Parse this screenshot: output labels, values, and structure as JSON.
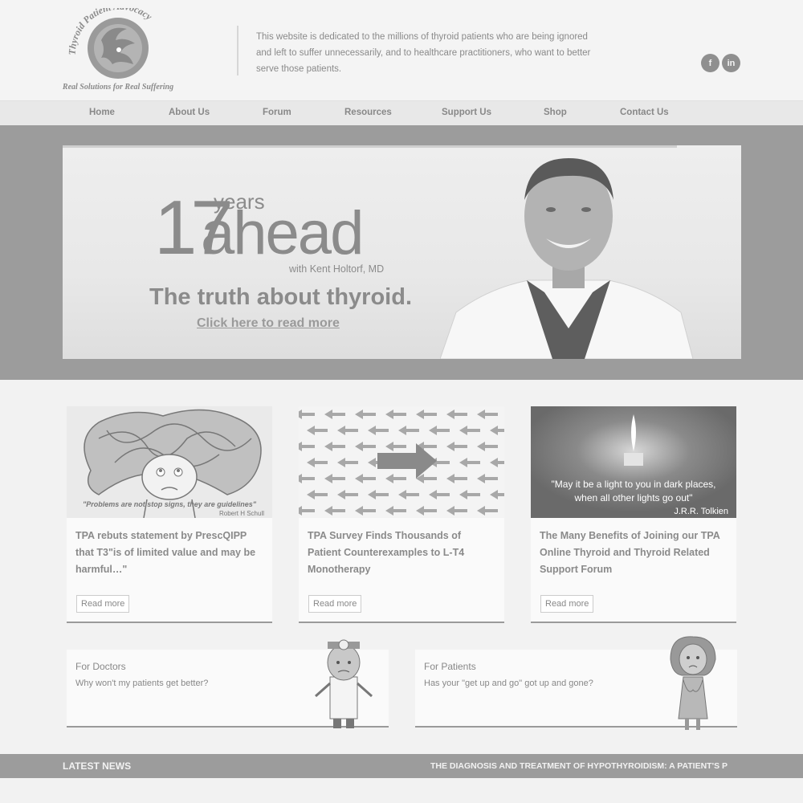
{
  "header": {
    "logo_arc_text": "Thyroid Patient Advocacy",
    "logo_tagline": "Real Solutions for Real Suffering",
    "tagline": "This website is dedicated to the millions of thyroid patients who are being ignored and left to suffer unnecessarily, and to healthcare practitioners, who want to better serve those patients.",
    "social": [
      {
        "icon": "facebook-icon",
        "glyph": "f"
      },
      {
        "icon": "linkedin-icon",
        "glyph": "in"
      }
    ]
  },
  "nav": {
    "items": [
      "Home",
      "About Us",
      "Forum",
      "Resources",
      "Support Us",
      "Shop",
      "Contact Us"
    ]
  },
  "hero": {
    "big_number": "17",
    "years": "years",
    "ahead": "ahead",
    "with": "with Kent Holtorf, MD",
    "headline": "The truth about thyroid.",
    "link": "Click here to read more"
  },
  "cards": [
    {
      "image_caption": "\"Problems are not stop signs, they are guidelines\"",
      "image_author": "Robert H Schull",
      "title": "TPA rebuts statement by PrescQIPP that T3\"is of limited value and may be harmful…\"",
      "button": "Read more"
    },
    {
      "title": "TPA Survey Finds Thousands of Patient Counterexamples to L-T4 Monotherapy",
      "button": "Read more"
    },
    {
      "image_quote_line1": "\"May it be a light to you in dark places,",
      "image_quote_line2": "when all other lights go out\"",
      "image_author": "J.R.R. Tolkien",
      "title": "The Many Benefits of Joining our TPA Online Thyroid and Thyroid Related Support Forum",
      "button": "Read more"
    }
  ],
  "features": [
    {
      "title": "For Doctors",
      "text": "Why won't my patients get better?"
    },
    {
      "title": "For Patients",
      "text": "Has your \"get up and go\" got up and gone?"
    }
  ],
  "news": {
    "label": "LATEST NEWS",
    "ticker": "THE DIAGNOSIS AND TREATMENT OF HYPOTHYROIDISM: A PATIENT'S P"
  }
}
